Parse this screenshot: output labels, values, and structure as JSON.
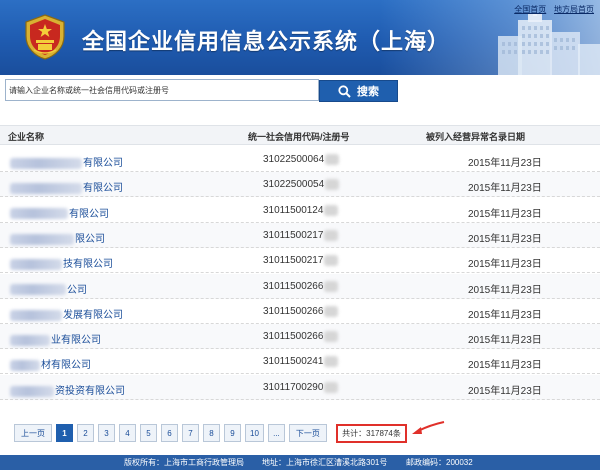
{
  "header": {
    "title": "全国企业信用信息公示系统（上海）",
    "links": [
      "全国首页",
      "地方局首页"
    ],
    "brand_color": "#1f5bb0"
  },
  "search": {
    "placeholder": "请输入企业名称或统一社会信用代码或注册号",
    "button_label": "搜索",
    "button_icon": "search-icon"
  },
  "table": {
    "columns": [
      "企业名称",
      "统一社会信用代码/注册号",
      "被列入经营异常名录日期"
    ],
    "rows": [
      {
        "name_visible": "有限公司",
        "code_visible": "31022500064",
        "date": "2015年11月23日"
      },
      {
        "name_visible": "有限公司",
        "code_visible": "31022500054",
        "date": "2015年11月23日"
      },
      {
        "name_visible": "有限公司",
        "code_visible": "31011500124",
        "date": "2015年11月23日"
      },
      {
        "name_visible": "限公司",
        "code_visible": "31011500217",
        "date": "2015年11月23日"
      },
      {
        "name_visible": "技有限公司",
        "code_visible": "31011500217",
        "date": "2015年11月23日"
      },
      {
        "name_visible": "公司",
        "code_visible": "31011500266",
        "date": "2015年11月23日"
      },
      {
        "name_visible": "发展有限公司",
        "code_visible": "31011500266",
        "date": "2015年11月23日"
      },
      {
        "name_visible": "业有限公司",
        "code_visible": "31011500266",
        "date": "2015年11月23日"
      },
      {
        "name_visible": "材有限公司",
        "code_visible": "31011500241",
        "date": "2015年11月23日"
      },
      {
        "name_visible": "资投资有限公司",
        "code_visible": "31011700290",
        "date": "2015年11月23日"
      }
    ]
  },
  "pagination": {
    "prev_label": "上一页",
    "pages": [
      "1",
      "2",
      "3",
      "4",
      "5",
      "6",
      "7",
      "8",
      "9",
      "10",
      "..."
    ],
    "current_page": "1",
    "next_label": "下一页",
    "total_label": "共计：317874条"
  },
  "footer": {
    "copyright": "版权所有：上海市工商行政管理局",
    "address": "地址：上海市徐汇区漕溪北路301号",
    "postcode": "邮政编码：200032"
  }
}
